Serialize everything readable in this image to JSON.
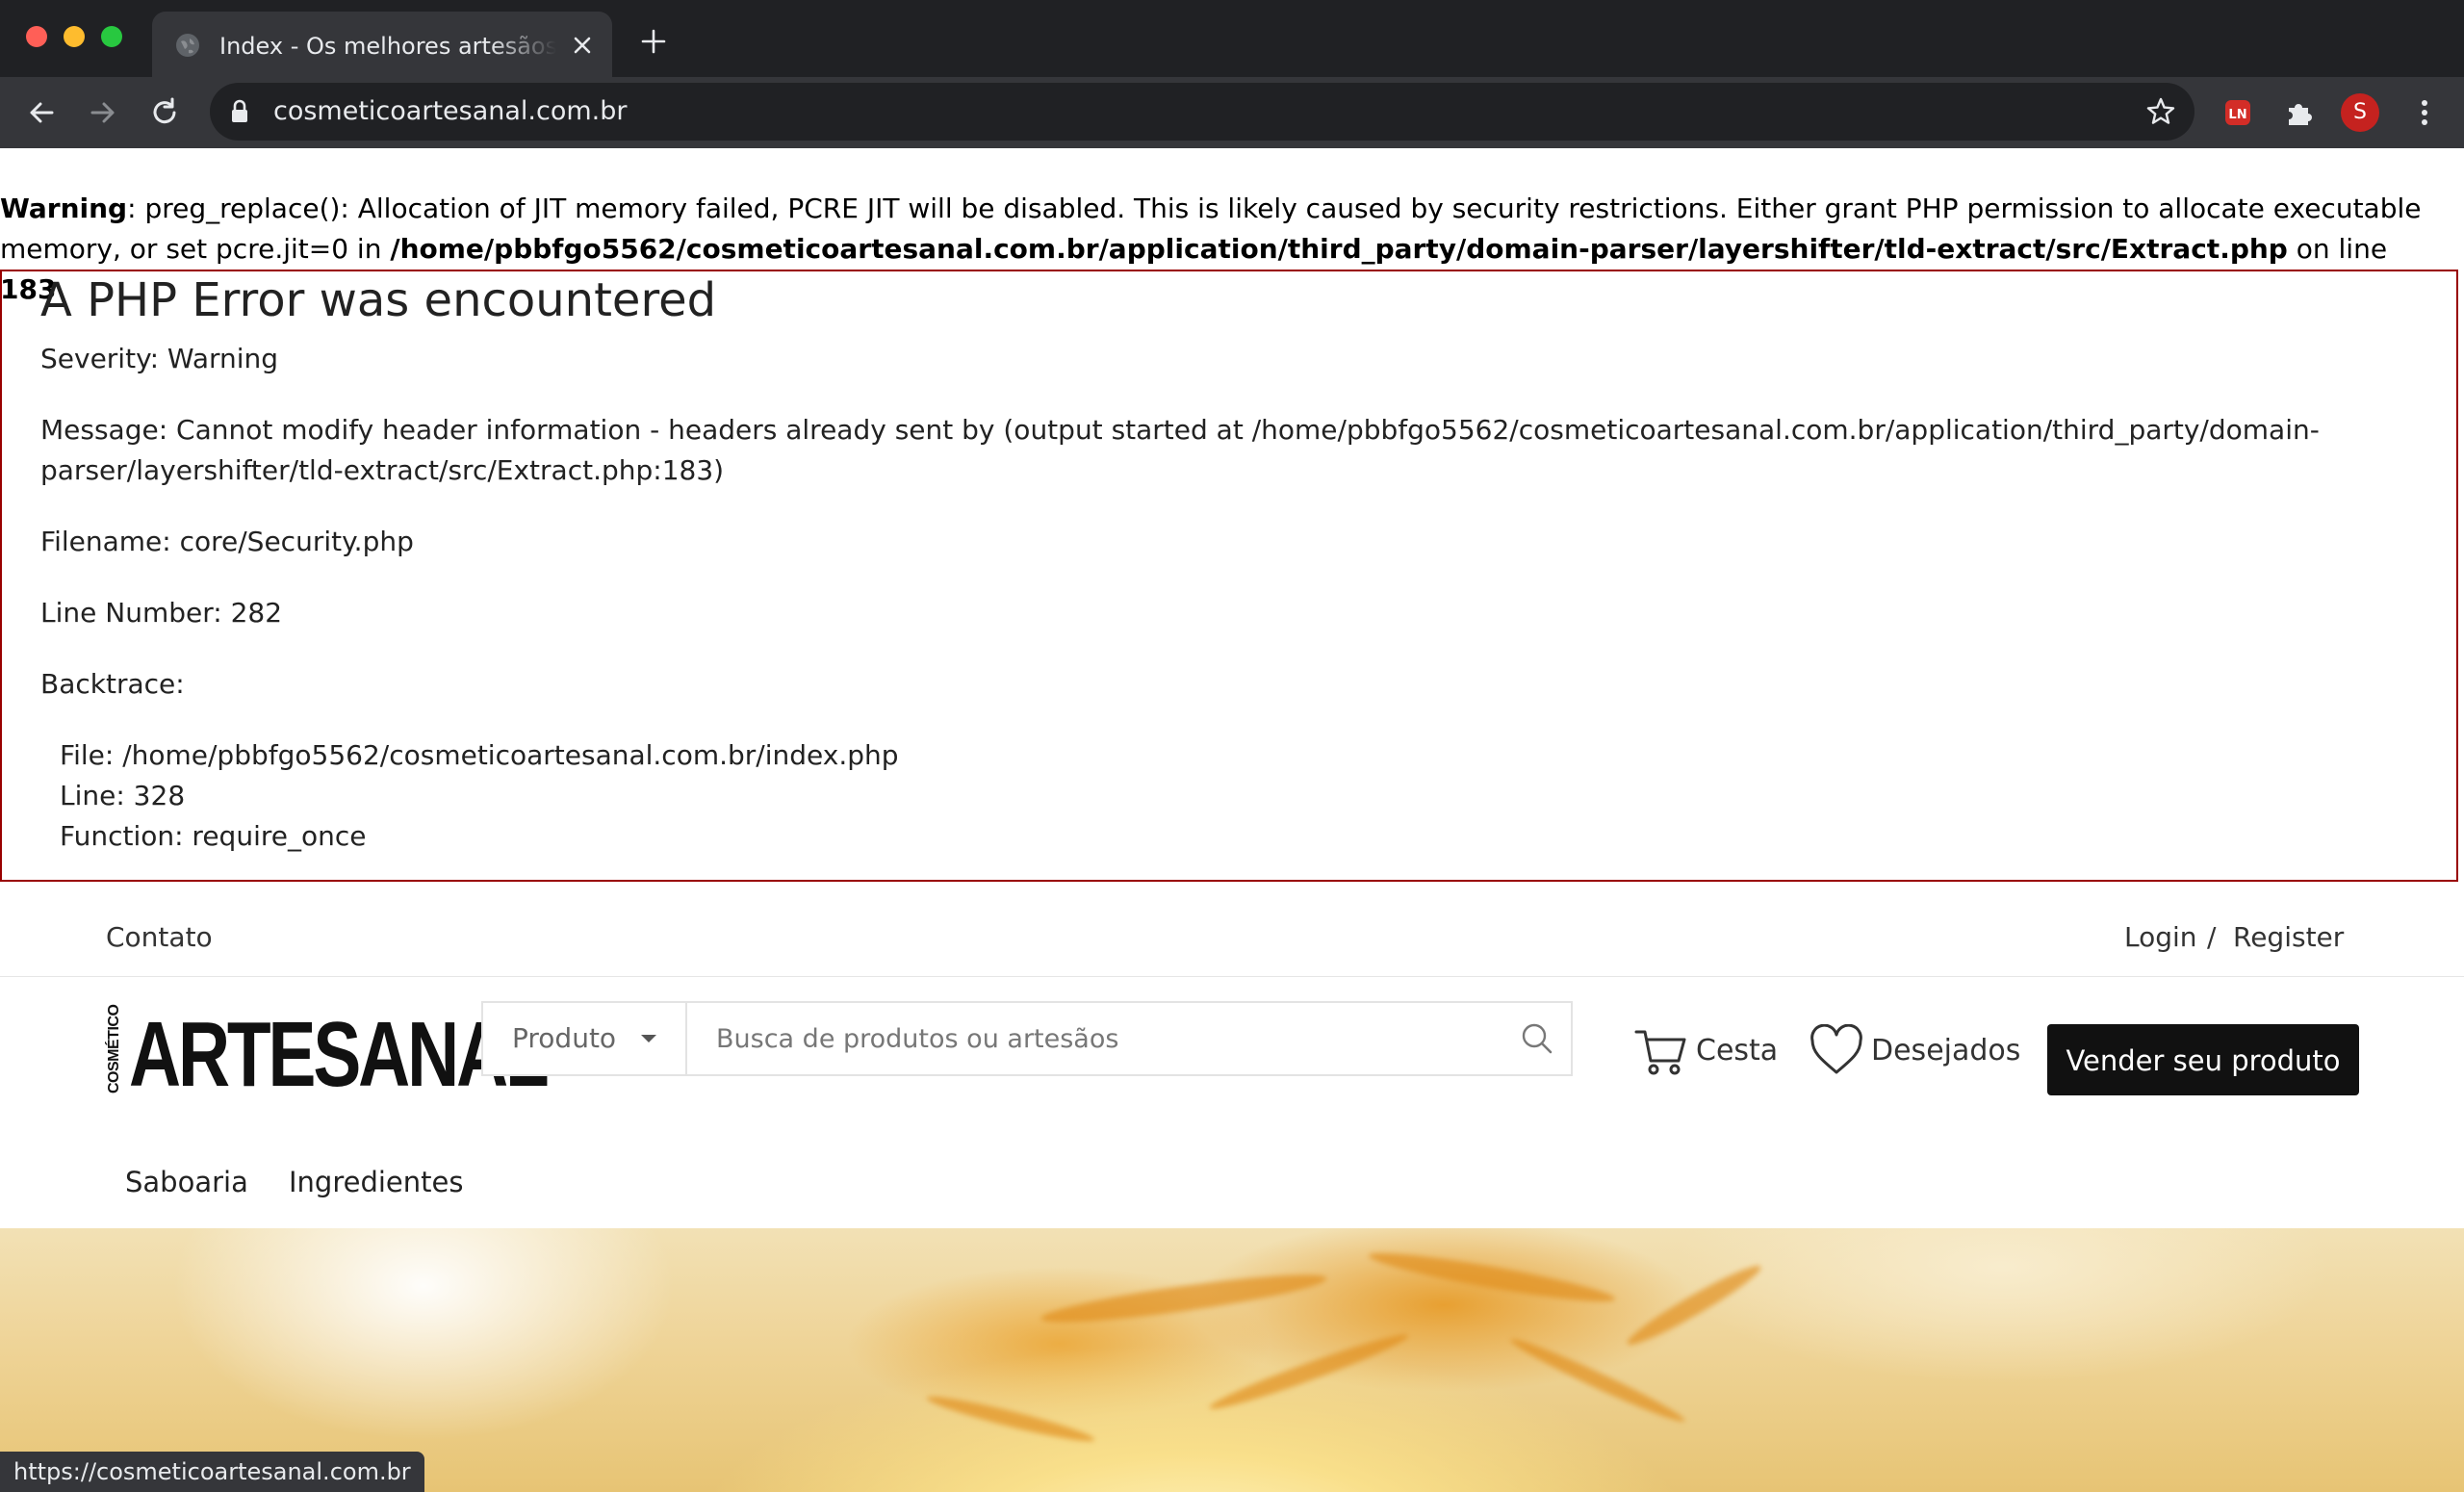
{
  "browser": {
    "tab_title": "Index - Os melhores artesãos e produtos artesanais",
    "url": "cosmeticoartesanal.com.br",
    "profile_initial": "S",
    "extension_badge": "LN",
    "status_url": "https://cosmeticoartesanal.com.br"
  },
  "warning": {
    "label": "Warning",
    "text": ": preg_replace(): Allocation of JIT memory failed, PCRE JIT will be disabled. This is likely caused by security restrictions. Either grant PHP permission to allocate executable memory, or set pcre.jit=0 in ",
    "path": "/home/pbbfgo5562/cosmeticoartesanal.com.br/application/third_party/domain-parser/layershifter/tld-extract/src/Extract.php",
    "on_line": " on line ",
    "line": "183"
  },
  "php_error": {
    "title": "A PHP Error was encountered",
    "severity": "Severity: Warning",
    "message": "Message: Cannot modify header information - headers already sent by (output started at /home/pbbfgo5562/cosmeticoartesanal.com.br/application/third_party/domain-parser/layershifter/tld-extract/src/Extract.php:183)",
    "filename": "Filename: core/Security.php",
    "line_number": "Line Number: 282",
    "backtrace_label": "Backtrace:",
    "bt_file": "File: /home/pbbfgo5562/cosmeticoartesanal.com.br/index.php",
    "bt_line": "Line: 328",
    "bt_function": "Function: require_once"
  },
  "topbar": {
    "contact": "Contato",
    "login": "Login",
    "separator": "/",
    "register": "Register"
  },
  "header": {
    "logo_small": "COSMÉTICO",
    "logo_big": "ARTESANAL",
    "search_category": "Produto",
    "search_placeholder": "Busca de produtos ou artesãos",
    "cart_label": "Cesta",
    "wishlist_label": "Desejados",
    "sell_button": "Vender seu produto"
  },
  "nav": {
    "items": [
      "Saboaria",
      "Ingredientes"
    ]
  },
  "colors": {
    "chrome_dark": "#202124",
    "chrome_toolbar": "#35363a",
    "error_border": "#990000",
    "button_bg": "#111111"
  }
}
